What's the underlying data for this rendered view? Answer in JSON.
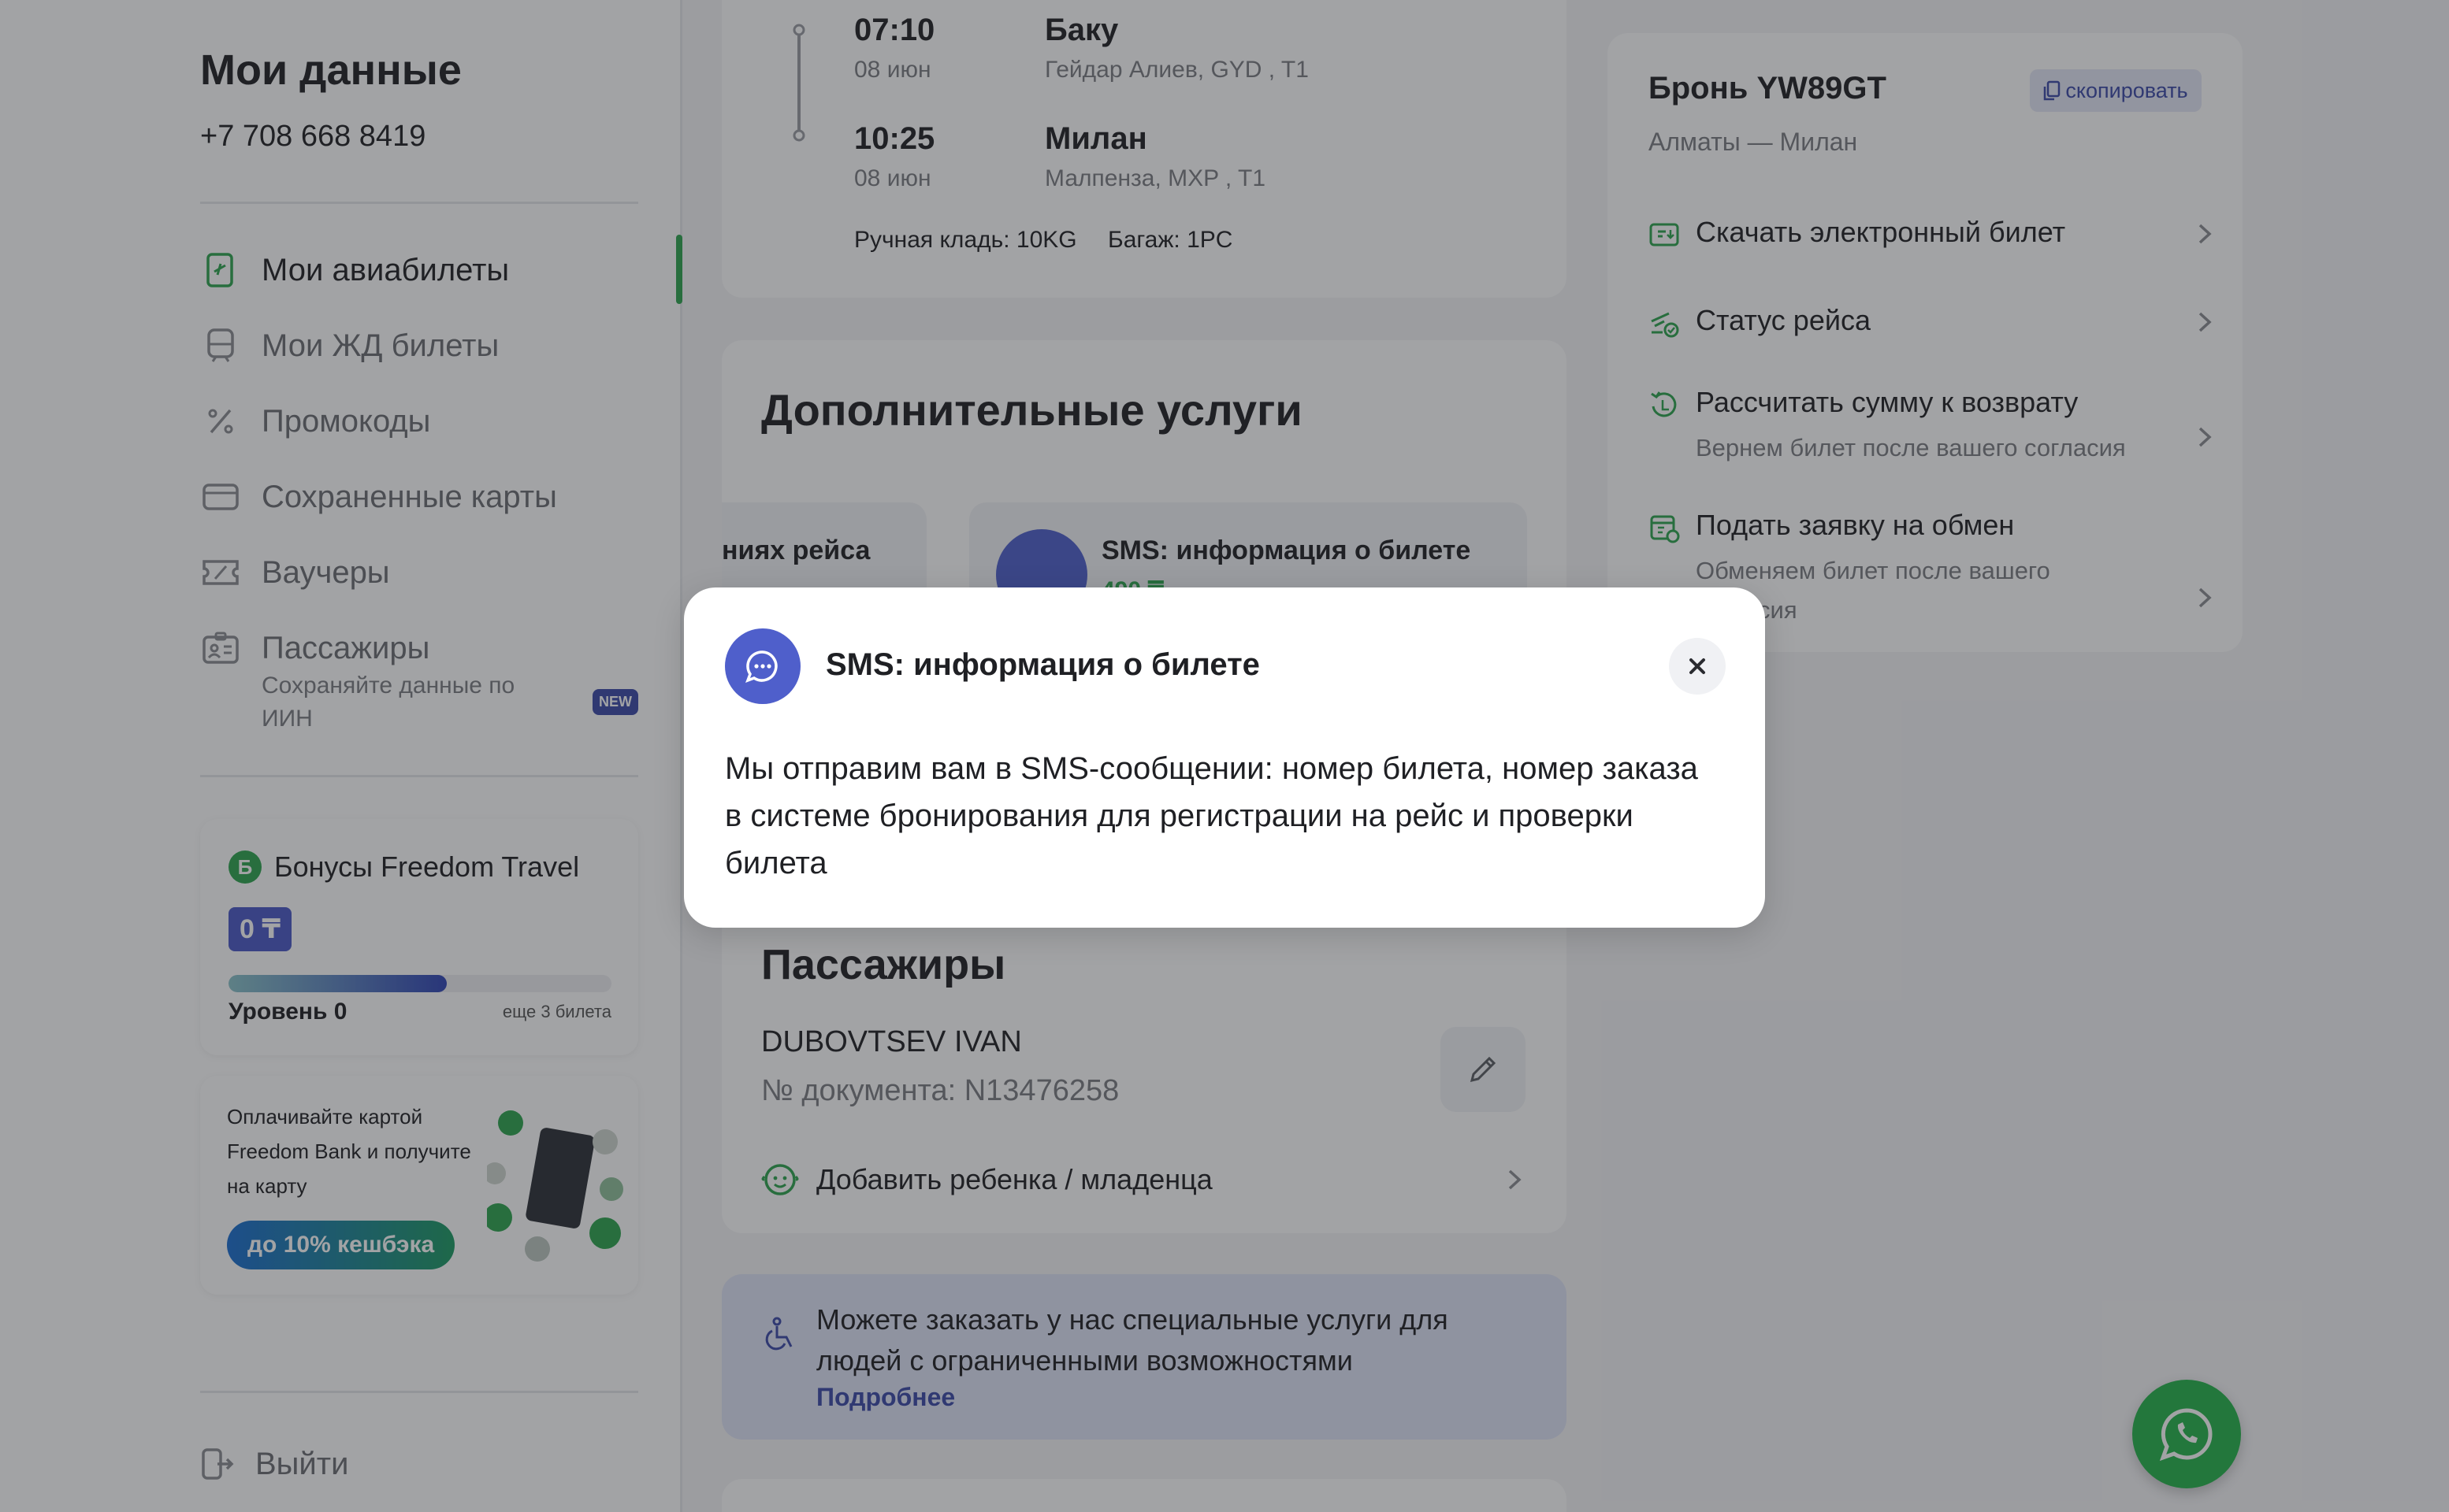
{
  "sidebar": {
    "title": "Мои данные",
    "phone": "+7 708 668 8419",
    "nav": [
      {
        "label": "Мои авиабилеты",
        "icon": "ticket-plane-icon",
        "active": true
      },
      {
        "label": "Мои ЖД билеты",
        "icon": "train-icon"
      },
      {
        "label": "Промокоды",
        "icon": "percent-icon"
      },
      {
        "label": "Сохраненные карты",
        "icon": "card-icon"
      },
      {
        "label": "Ваучеры",
        "icon": "voucher-icon"
      },
      {
        "label": "Пассажиры",
        "icon": "passengers-icon",
        "sub": "Сохраняйте данные по ИИН",
        "badge": "NEW"
      }
    ],
    "bonus": {
      "logo": "Б",
      "title": "Бонусы Freedom Travel",
      "amount": "0 ₸",
      "level": "Уровень 0",
      "remaining": "еще 3 билета",
      "progress": 0.57
    },
    "promo": {
      "text": "Оплачивайте картой Freedom Bank и получите на карту",
      "button": "до 10% кешбэка"
    },
    "logout": "Выйти"
  },
  "flight": {
    "depart_time": "07:10",
    "depart_date": "08 июн",
    "depart_city": "Баку",
    "depart_airport": "Гейдар Алиев, GYD , T1",
    "arrive_time": "10:25",
    "arrive_date": "08 июн",
    "arrive_city": "Милан",
    "arrive_airport": "Малпенза, MXP , T1",
    "hand_baggage": "Ручная кладь: 10KG",
    "baggage": "Багаж: 1PC"
  },
  "services": {
    "title": "Дополнительные услуги",
    "tiles": [
      {
        "title": "ниях рейса"
      },
      {
        "title": "SMS: информация о билете",
        "price": "490 ₸"
      }
    ]
  },
  "passengers": {
    "title": "Пассажиры",
    "name": "DUBOVTSEV IVAN",
    "document": "№ документа: N13476258",
    "add_child": "Добавить ребенка / младенца"
  },
  "accessibility": {
    "text": "Можете заказать у нас специальные услуги для людей с ограниченными возможностями",
    "link": "Подробнее"
  },
  "booking": {
    "title": "Бронь YW89GT",
    "copy": "скопировать",
    "route": "Алматы — Милан",
    "items": [
      {
        "label": "Скачать электронный билет",
        "icon": "download-ticket-icon"
      },
      {
        "label": "Статус рейса",
        "icon": "flight-status-icon"
      },
      {
        "label": "Рассчитать сумму к возврату",
        "sub": "Вернем билет после вашего согласия",
        "icon": "refund-icon"
      },
      {
        "label": "Подать заявку на обмен",
        "sub": "Обменяем билет после вашего согласия",
        "icon": "exchange-icon"
      }
    ]
  },
  "modal": {
    "title": "SMS: информация о билете",
    "body": "Мы отправим вам в SMS-сообщении: номер билета, номер заказа в системе бронирования для регистрации на рейс и проверки билета"
  },
  "colors": {
    "accent_green": "#2ea44f",
    "accent_blue": "#4f5fcb",
    "link_blue": "#3b49a8"
  }
}
